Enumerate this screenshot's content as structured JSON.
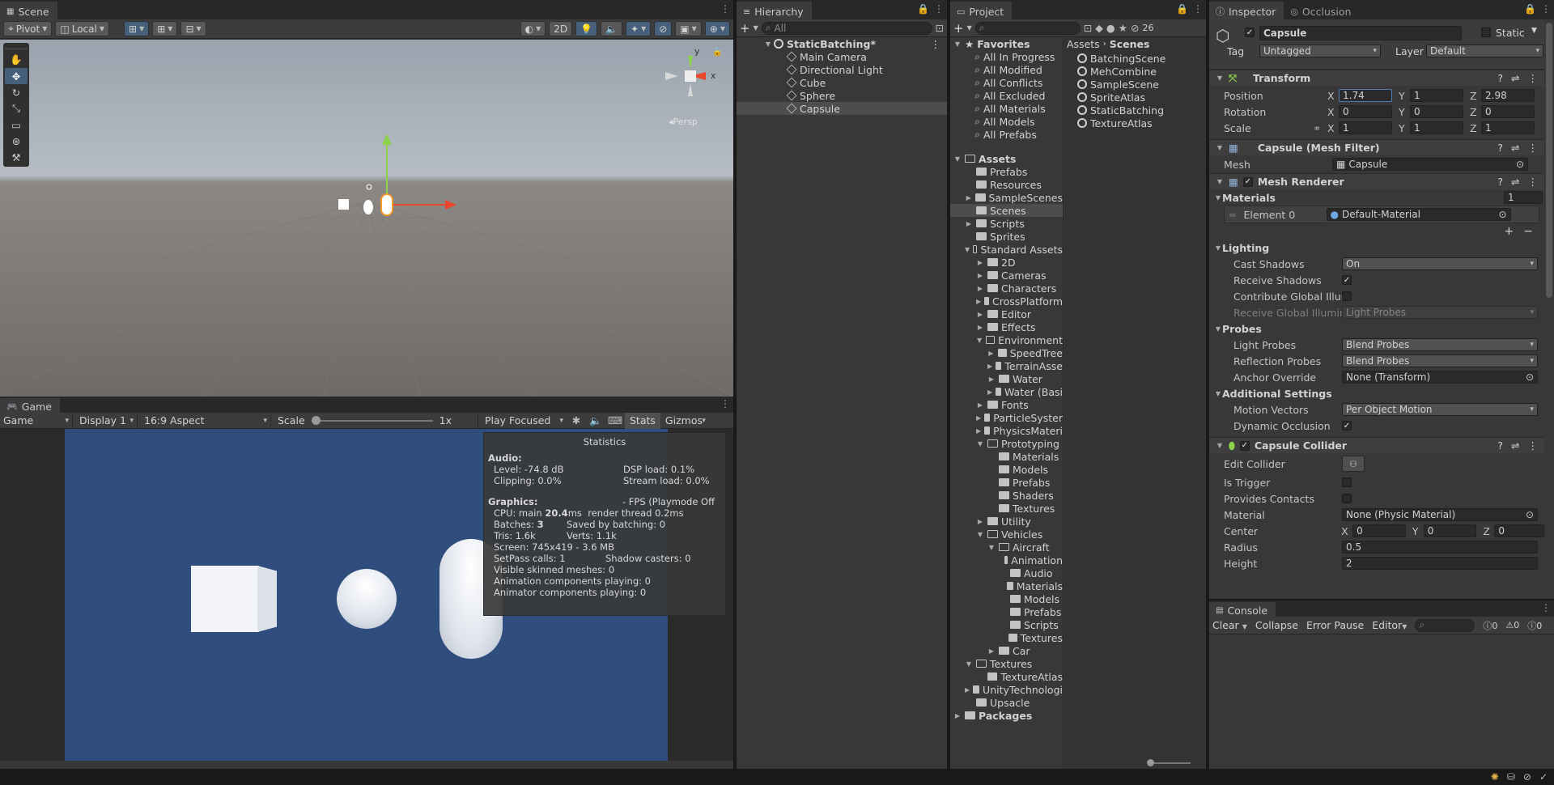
{
  "scene": {
    "tab": "Scene",
    "pivot": "Pivot",
    "local": "Local",
    "mode_2d": "2D",
    "persp": "Persp",
    "gizmo_x": "x",
    "gizmo_y": "y"
  },
  "game": {
    "tab": "Game",
    "mode": "Game",
    "display": "Display 1",
    "aspect": "16:9 Aspect",
    "scale_label": "Scale",
    "scale_value": "1x",
    "play_focused": "Play Focused",
    "stats": "Stats",
    "gizmos": "Gizmos",
    "statistics": {
      "title": "Statistics",
      "audio_heading": "Audio:",
      "level": "Level: -74.8 dB",
      "clipping": "Clipping: 0.0%",
      "dsp": "DSP load: 0.1%",
      "stream": "Stream load: 0.0%",
      "graphics_heading": "Graphics:",
      "fps": "- FPS (Playmode Off",
      "cpu_prefix": "CPU: main ",
      "cpu_main": "20.4",
      "cpu_suffix": "ms  render thread 0.2ms",
      "batches_prefix": "Batches: ",
      "batches": "3",
      "saved": "Saved by batching: 0",
      "tris": "Tris: 1.6k",
      "verts": "Verts: 1.1k",
      "screen": "Screen: 745x419 - 3.6 MB",
      "setpass": "SetPass calls: 1",
      "shadow": "Shadow casters: 0",
      "skinned": "Visible skinned meshes: 0",
      "animation": "Animation components playing: 0",
      "animator": "Animator components playing: 0"
    }
  },
  "hierarchy": {
    "tab": "Hierarchy",
    "search_placeholder": "All",
    "scene_name": "StaticBatching*",
    "items": [
      "Main Camera",
      "Directional Light",
      "Cube",
      "Sphere",
      "Capsule"
    ]
  },
  "project": {
    "tab": "Project",
    "hidden_count": "26",
    "favorites_label": "Favorites",
    "favorites": [
      "All In Progress",
      "All Modified",
      "All Conflicts",
      "All Excluded",
      "All Materials",
      "All Models",
      "All Prefabs"
    ],
    "assets_label": "Assets",
    "breadcrumb_root": "Assets",
    "breadcrumb_current": "Scenes",
    "tree": [
      {
        "label": "Prefabs",
        "indent": 1,
        "arrow": "",
        "open": false
      },
      {
        "label": "Resources",
        "indent": 1,
        "arrow": "",
        "open": false
      },
      {
        "label": "SampleScenes",
        "indent": 1,
        "arrow": "▶",
        "open": false
      },
      {
        "label": "Scenes",
        "indent": 1,
        "arrow": "",
        "open": false,
        "selected": true
      },
      {
        "label": "Scripts",
        "indent": 1,
        "arrow": "▶",
        "open": false
      },
      {
        "label": "Sprites",
        "indent": 1,
        "arrow": "",
        "open": false
      },
      {
        "label": "Standard Assets",
        "indent": 1,
        "arrow": "▼",
        "open": true
      },
      {
        "label": "2D",
        "indent": 2,
        "arrow": "▶",
        "open": false
      },
      {
        "label": "Cameras",
        "indent": 2,
        "arrow": "▶",
        "open": false
      },
      {
        "label": "Characters",
        "indent": 2,
        "arrow": "▶",
        "open": false
      },
      {
        "label": "CrossPlatform",
        "indent": 2,
        "arrow": "▶",
        "open": false
      },
      {
        "label": "Editor",
        "indent": 2,
        "arrow": "▶",
        "open": false
      },
      {
        "label": "Effects",
        "indent": 2,
        "arrow": "▶",
        "open": false
      },
      {
        "label": "Environment",
        "indent": 2,
        "arrow": "▼",
        "open": true
      },
      {
        "label": "SpeedTree",
        "indent": 3,
        "arrow": "▶",
        "open": false
      },
      {
        "label": "TerrainAsse",
        "indent": 3,
        "arrow": "▶",
        "open": false
      },
      {
        "label": "Water",
        "indent": 3,
        "arrow": "▶",
        "open": false
      },
      {
        "label": "Water (Basi",
        "indent": 3,
        "arrow": "▶",
        "open": false
      },
      {
        "label": "Fonts",
        "indent": 2,
        "arrow": "▶",
        "open": false
      },
      {
        "label": "ParticleSyster",
        "indent": 2,
        "arrow": "▶",
        "open": false
      },
      {
        "label": "PhysicsMateri",
        "indent": 2,
        "arrow": "▶",
        "open": false
      },
      {
        "label": "Prototyping",
        "indent": 2,
        "arrow": "▼",
        "open": true
      },
      {
        "label": "Materials",
        "indent": 3,
        "arrow": "",
        "open": false
      },
      {
        "label": "Models",
        "indent": 3,
        "arrow": "",
        "open": false
      },
      {
        "label": "Prefabs",
        "indent": 3,
        "arrow": "",
        "open": false
      },
      {
        "label": "Shaders",
        "indent": 3,
        "arrow": "",
        "open": false
      },
      {
        "label": "Textures",
        "indent": 3,
        "arrow": "",
        "open": false
      },
      {
        "label": "Utility",
        "indent": 2,
        "arrow": "▶",
        "open": false
      },
      {
        "label": "Vehicles",
        "indent": 2,
        "arrow": "▼",
        "open": true
      },
      {
        "label": "Aircraft",
        "indent": 3,
        "arrow": "▼",
        "open": true
      },
      {
        "label": "Animation",
        "indent": 4,
        "arrow": "",
        "open": false
      },
      {
        "label": "Audio",
        "indent": 4,
        "arrow": "",
        "open": false
      },
      {
        "label": "Materials",
        "indent": 4,
        "arrow": "",
        "open": false
      },
      {
        "label": "Models",
        "indent": 4,
        "arrow": "",
        "open": false
      },
      {
        "label": "Prefabs",
        "indent": 4,
        "arrow": "",
        "open": false
      },
      {
        "label": "Scripts",
        "indent": 4,
        "arrow": "",
        "open": false
      },
      {
        "label": "Textures",
        "indent": 4,
        "arrow": "",
        "open": false
      },
      {
        "label": "Car",
        "indent": 3,
        "arrow": "▶",
        "open": false
      },
      {
        "label": "Textures",
        "indent": 1,
        "arrow": "▼",
        "open": true
      },
      {
        "label": "TextureAtlas",
        "indent": 2,
        "arrow": "",
        "open": false
      },
      {
        "label": "UnityTechnologi",
        "indent": 1,
        "arrow": "▶",
        "open": false
      },
      {
        "label": "Upsacle",
        "indent": 1,
        "arrow": "",
        "open": false
      }
    ],
    "packages_label": "Packages",
    "files": [
      "BatchingScene",
      "MehCombine",
      "SampleScene",
      "SpriteAtlas",
      "StaticBatching",
      "TextureAtlas"
    ]
  },
  "inspector": {
    "tab": "Inspector",
    "tab2": "Occlusion",
    "object_name": "Capsule",
    "static_label": "Static",
    "tag_label": "Tag",
    "tag_value": "Untagged",
    "layer_label": "Layer",
    "layer_value": "Default",
    "transform": {
      "title": "Transform",
      "position_label": "Position",
      "pos_x": "1.74",
      "pos_y": "1",
      "pos_z": "2.98",
      "rotation_label": "Rotation",
      "rot_x": "0",
      "rot_y": "0",
      "rot_z": "0",
      "scale_label": "Scale",
      "scale_x": "1",
      "scale_y": "1",
      "scale_z": "1"
    },
    "mesh_filter": {
      "title": "Capsule (Mesh Filter)",
      "mesh_label": "Mesh",
      "mesh_value": "Capsule"
    },
    "mesh_renderer": {
      "title": "Mesh Renderer",
      "materials_label": "Materials",
      "materials_count": "1",
      "element_label": "Element 0",
      "element_value": "Default-Material",
      "lighting_label": "Lighting",
      "cast_shadows_label": "Cast Shadows",
      "cast_shadows_value": "On",
      "receive_shadows_label": "Receive Shadows",
      "contribute_gi_label": "Contribute Global Illumi",
      "receive_gi_label": "Receive Global Illumina",
      "receive_gi_value": "Light Probes",
      "probes_label": "Probes",
      "light_probes_label": "Light Probes",
      "light_probes_value": "Blend Probes",
      "reflection_probes_label": "Reflection Probes",
      "reflection_probes_value": "Blend Probes",
      "anchor_label": "Anchor Override",
      "anchor_value": "None (Transform)",
      "additional_label": "Additional Settings",
      "motion_label": "Motion Vectors",
      "motion_value": "Per Object Motion",
      "dynamic_label": "Dynamic Occlusion"
    },
    "collider": {
      "title": "Capsule Collider",
      "edit_label": "Edit Collider",
      "trigger_label": "Is Trigger",
      "contacts_label": "Provides Contacts",
      "material_label": "Material",
      "material_value": "None (Physic Material)",
      "center_label": "Center",
      "cx": "0",
      "cy": "0",
      "cz": "0",
      "radius_label": "Radius",
      "radius_value": "0.5",
      "height_label": "Height",
      "height_value": "2"
    }
  },
  "console": {
    "tab": "Console",
    "clear": "Clear",
    "collapse": "Collapse",
    "error_pause": "Error Pause",
    "editor": "Editor",
    "count_log": "0",
    "count_warn": "0",
    "count_err": "0"
  }
}
